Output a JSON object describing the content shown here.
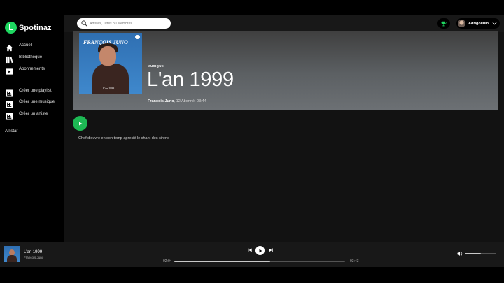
{
  "app": {
    "name": "Spotinaz",
    "brand_color": "#1ed760"
  },
  "sidebar": {
    "items": [
      {
        "label": "Accueil",
        "icon": "home-icon"
      },
      {
        "label": "Bibliothèque",
        "icon": "library-icon"
      },
      {
        "label": "Abonnements",
        "icon": "subscriptions-icon"
      },
      {
        "label": "Créer une playlist",
        "icon": "add-playlist-icon"
      },
      {
        "label": "Créer une musique",
        "icon": "add-music-icon"
      },
      {
        "label": "Créer un artiste",
        "icon": "add-artist-icon"
      }
    ],
    "extra_link": "All star"
  },
  "topbar": {
    "search_placeholder": "Artistes, Titres ou Membres",
    "user_name": "Adrigollum"
  },
  "track": {
    "type_label": "MUSIQUE",
    "title": "L'an 1999",
    "artist": "Francois Juno",
    "subscribers": "12 Abonné",
    "duration": "03:44",
    "description": "Chef d'ouvre en son temp aprecié le chant des sirene",
    "cover": {
      "title_text": "FRANÇOIS JUNO",
      "caption_text": "L'an 1999"
    }
  },
  "player": {
    "title": "L'an 1999",
    "artist": "Francois Juno",
    "elapsed": "02:04",
    "total": "03:43",
    "progress_fraction": 0.56,
    "volume_fraction": 0.5
  }
}
